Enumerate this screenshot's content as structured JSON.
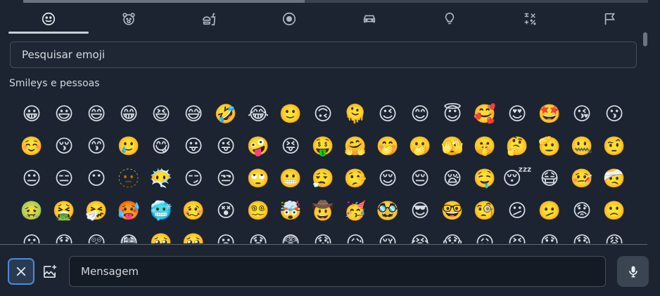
{
  "colors": {
    "background": "#1b2430",
    "accent_focus": "#4f89d8",
    "divider": "#5d6673"
  },
  "tabs": [
    {
      "name": "smileys",
      "icon": "smiley-icon",
      "active": true
    },
    {
      "name": "animals",
      "icon": "bear-icon",
      "active": false
    },
    {
      "name": "food",
      "icon": "burger-drink-icon",
      "active": false
    },
    {
      "name": "activities",
      "icon": "ball-icon",
      "active": false
    },
    {
      "name": "travel",
      "icon": "car-icon",
      "active": false
    },
    {
      "name": "objects",
      "icon": "lightbulb-icon",
      "active": false
    },
    {
      "name": "symbols",
      "icon": "symbols-icon",
      "active": false
    },
    {
      "name": "flags",
      "icon": "flag-icon",
      "active": false
    }
  ],
  "search": {
    "placeholder": "Pesquisar emoji"
  },
  "section": {
    "title": "Smileys e pessoas"
  },
  "emojis": [
    "😀",
    "😃",
    "😄",
    "😁",
    "😆",
    "😅",
    "🤣",
    "😂",
    "🙂",
    "🙃",
    "🫠",
    "😉",
    "😊",
    "😇",
    "🥰",
    "😍",
    "🤩",
    "😘",
    "😗",
    "☺️",
    "😚",
    "😙",
    "🥲",
    "😋",
    "😛",
    "😜",
    "🤪",
    "😝",
    "🤑",
    "🤗",
    "🤭",
    "🫢",
    "🫣",
    "🤫",
    "🤔",
    "🫡",
    "🤐",
    "🤨",
    "😐",
    "😑",
    "😶",
    "🫥",
    "😶‍🌫️",
    "😏",
    "😒",
    "🙄",
    "😬",
    "😮‍💨",
    "🤥",
    "😌",
    "😔",
    "😪",
    "🤤",
    "😴",
    "😷",
    "🤒",
    "🤕",
    "🤢",
    "🤮",
    "🤧",
    "🥵",
    "🥶",
    "🥴",
    "😵",
    "😵‍💫",
    "🤯",
    "🤠",
    "🥳",
    "🥸",
    "😎",
    "🤓",
    "🧐",
    "😕",
    "🫤",
    "😟",
    "🙁",
    "😮",
    "😯",
    "😲",
    "😳",
    "🥺",
    "🥹",
    "😦",
    "😧",
    "😨",
    "😰",
    "😥",
    "😢",
    "😭",
    "😱",
    "😖",
    "😣",
    "😞",
    "😓",
    "😩"
  ],
  "composer": {
    "close_icon": "close-icon",
    "image_icon": "add-image-icon",
    "message_placeholder": "Mensagem",
    "mic_icon": "microphone-icon"
  }
}
